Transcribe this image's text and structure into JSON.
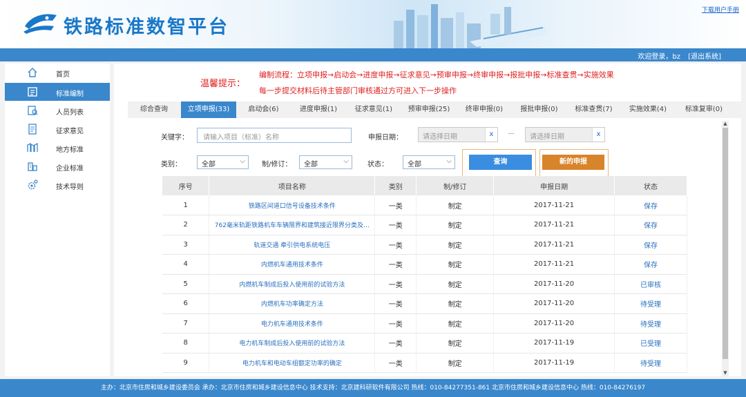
{
  "header": {
    "title": "铁路标准数智平台",
    "manual_link": "下载用户手册",
    "welcome": "欢迎登录，bz",
    "logout": "[退出系统]"
  },
  "sidebar": {
    "items": [
      {
        "label": "首页",
        "icon": "home-icon"
      },
      {
        "label": "标准编制",
        "icon": "list-icon",
        "active": true
      },
      {
        "label": "人员列表",
        "icon": "person-search-icon"
      },
      {
        "label": "征求意见",
        "icon": "document-icon"
      },
      {
        "label": "地方标准",
        "icon": "building-icon"
      },
      {
        "label": "企业标准",
        "icon": "enterprise-icon"
      },
      {
        "label": "技术导则",
        "icon": "gear-icon"
      }
    ]
  },
  "tip": {
    "label": "温馨提示：",
    "line1": "编制流程：立项申报→启动会→进度申报→征求意见→预审申报→终审申报→报批申报→标准查贯→实施效果",
    "line2": "每一步提交材料后待主管部门审核通过方可进入下一步操作"
  },
  "tabs": [
    {
      "label": "综合查询"
    },
    {
      "label": "立项申报(33)",
      "active": true
    },
    {
      "label": "启动会(6)"
    },
    {
      "label": "进度申报(1)"
    },
    {
      "label": "征求意见(1)"
    },
    {
      "label": "预审申报(25)"
    },
    {
      "label": "终审申报(0)"
    },
    {
      "label": "报批申报(0)"
    },
    {
      "label": "标准查贯(7)"
    },
    {
      "label": "实施效果(4)"
    },
    {
      "label": "标准复审(0)"
    }
  ],
  "filters": {
    "keyword_label": "关键字：",
    "keyword_placeholder": "请输入项目（标准）名称",
    "date_label": "申报日期：",
    "date_start_placeholder": "请选择日期",
    "date_sep": "—",
    "date_end_placeholder": "请选择日期",
    "date_clear": "x",
    "category_label": "类别：",
    "category_value": "全部",
    "revision_label": "制/修订：",
    "revision_value": "全部",
    "status_label": "状态：",
    "status_value": "全部",
    "search_button": "查询",
    "new_button": "新的申报"
  },
  "table": {
    "columns": [
      "序号",
      "项目名称",
      "类别",
      "制/修订",
      "申报日期",
      "状态"
    ],
    "rows": [
      [
        "1",
        "铁路区间道口信号设备技术条件",
        "一类",
        "制定",
        "2017-11-21",
        "保存"
      ],
      [
        "2",
        "762毫米轨距铁路机车车辆限界和建筑接近限界分类及…",
        "一类",
        "制定",
        "2017-11-21",
        "保存"
      ],
      [
        "3",
        "轨道交通 牵引供电系统电压",
        "一类",
        "制定",
        "2017-11-21",
        "保存"
      ],
      [
        "4",
        "内燃机车通用技术条件",
        "一类",
        "制定",
        "2017-11-21",
        "保存"
      ],
      [
        "5",
        "内燃机车制成后投入使用前的试验方法",
        "一类",
        "制定",
        "2017-11-20",
        "已审核"
      ],
      [
        "6",
        "内燃机车功率确定方法",
        "一类",
        "制定",
        "2017-11-20",
        "待受理"
      ],
      [
        "7",
        "电力机车通用技术条件",
        "一类",
        "制定",
        "2017-11-20",
        "待受理"
      ],
      [
        "8",
        "电力机车制成后投入使用前的试验方法",
        "一类",
        "制定",
        "2017-11-19",
        "已受理"
      ],
      [
        "9",
        "电力机车和电动车组额定功率的确定",
        "一类",
        "制定",
        "2017-11-19",
        "待受理"
      ]
    ]
  },
  "footer": {
    "text": "主办：北京市住房和城乡建设委员会    承办：北京市住房和城乡建设信息中心    技术支持：北京建科研软件有限公司 热线：010-84277351-861    北京市住房和城乡建设信息中心 热线：010-84276197"
  },
  "colors": {
    "primary": "#3a87cc",
    "accent_orange": "#d8842a",
    "warning_red": "#e02020",
    "link_blue": "#2a6fbf"
  }
}
